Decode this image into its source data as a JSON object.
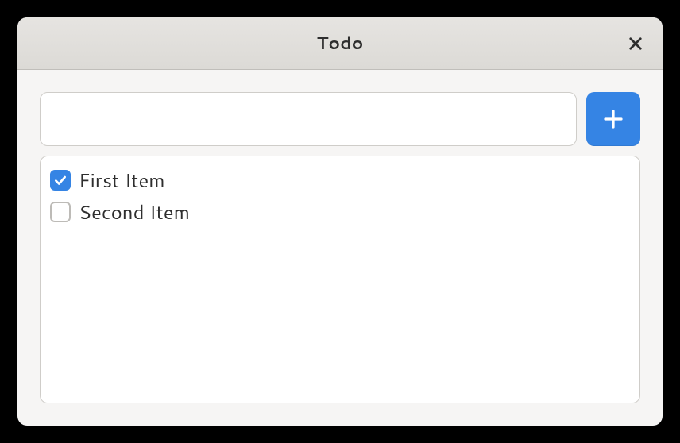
{
  "window": {
    "title": "Todo"
  },
  "input": {
    "value": "",
    "placeholder": ""
  },
  "items": [
    {
      "label": "First Item",
      "checked": true
    },
    {
      "label": "Second Item",
      "checked": false
    }
  ]
}
